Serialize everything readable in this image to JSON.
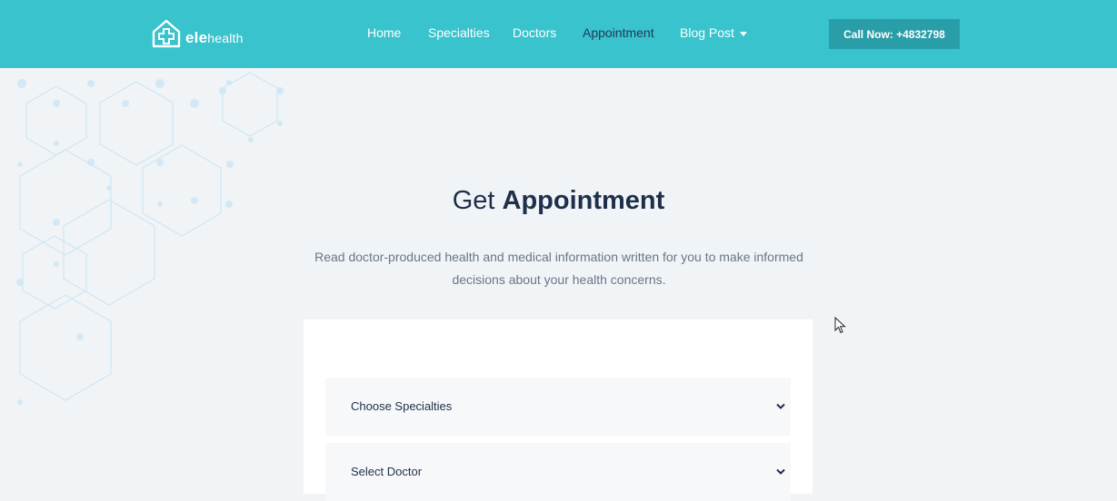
{
  "header": {
    "logo_text_bold": "ele",
    "logo_text_rest": "health",
    "nav": [
      {
        "label": "Home",
        "active": false
      },
      {
        "label": "Specialties",
        "active": false
      },
      {
        "label": "Doctors",
        "active": false
      },
      {
        "label": "Appointment",
        "active": true
      },
      {
        "label": "Blog Post",
        "active": false,
        "has_dropdown": true
      }
    ],
    "call_button": "Call Now: +4832798"
  },
  "main": {
    "heading_light": "Get",
    "heading_bold": "Appointment",
    "description": "Read doctor-produced health and medical information written for you to make informed decisions about your health concerns.",
    "form": {
      "specialty_select": "Choose Specialties",
      "doctor_select": "Select Doctor"
    }
  },
  "colors": {
    "brand": "#38c3cd",
    "button": "#2a9ea8",
    "page_bg": "#f0f4f7",
    "heading": "#1f2f4a"
  }
}
